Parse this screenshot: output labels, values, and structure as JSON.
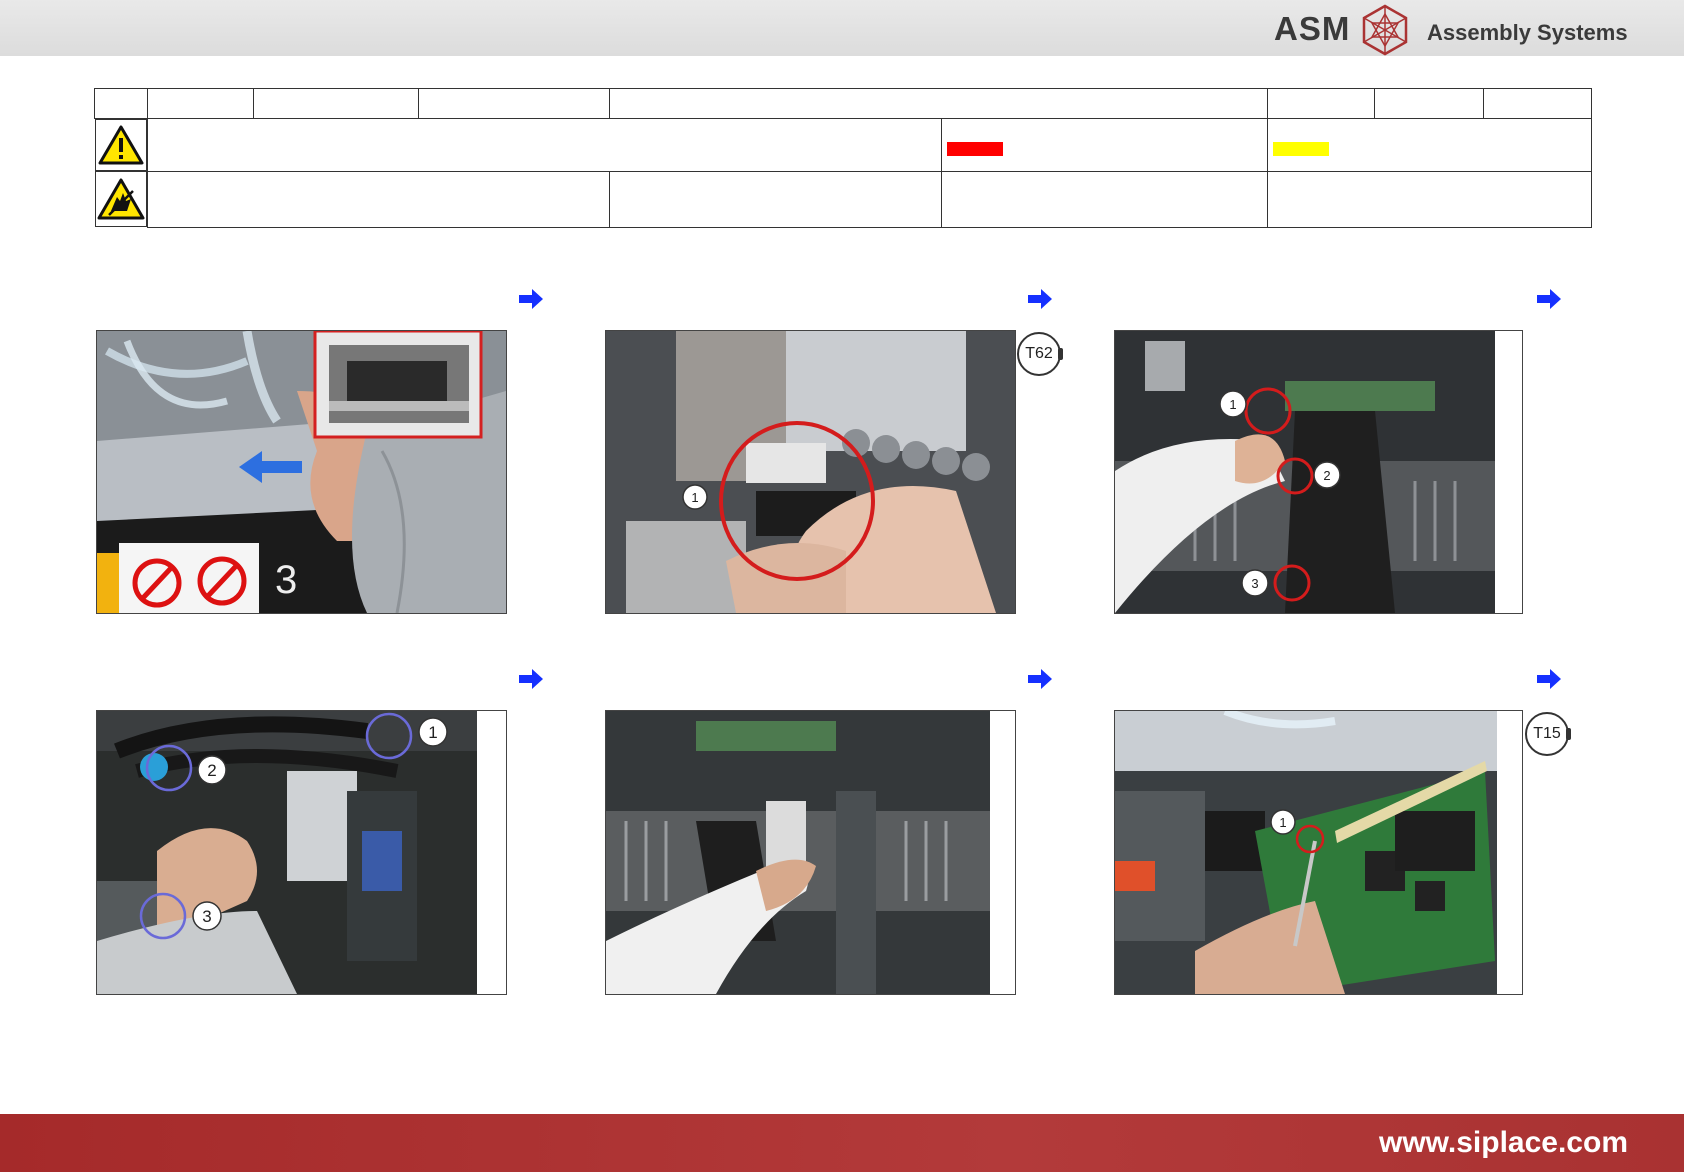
{
  "header": {
    "brand": "ASM",
    "subtitle": "Assembly Systems"
  },
  "info_table": {
    "warning_symbol": "warning-triangle-icon",
    "esd_symbol": "esd-hand-icon",
    "swatch_colors": [
      "#ff0000",
      "#ffff00"
    ]
  },
  "steps": [
    {
      "row": 1,
      "col": 1,
      "photo": "remove-cover-photo",
      "has_inset": true
    },
    {
      "row": 1,
      "col": 2,
      "photo": "sensor-removal-photo",
      "callouts": [
        "1"
      ],
      "tool": "T62"
    },
    {
      "row": 1,
      "col": 3,
      "photo": "head-connectors-photo",
      "callouts": [
        "1",
        "2",
        "3"
      ]
    },
    {
      "row": 2,
      "col": 1,
      "photo": "hose-connections-photo",
      "callouts": [
        "1",
        "2",
        "3"
      ]
    },
    {
      "row": 2,
      "col": 2,
      "photo": "cable-removal-photo"
    },
    {
      "row": 2,
      "col": 3,
      "photo": "board-screw-photo",
      "callouts": [
        "1"
      ],
      "tool": "T15"
    }
  ],
  "footer": {
    "url": "www.siplace.com"
  }
}
